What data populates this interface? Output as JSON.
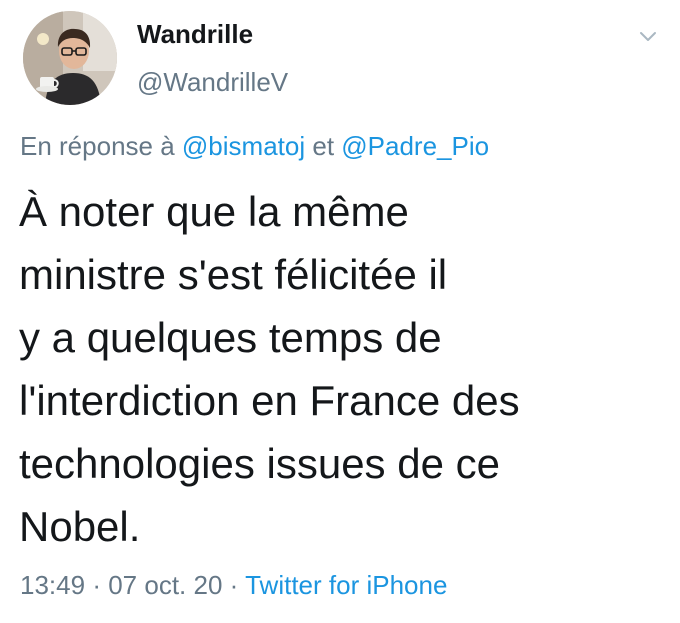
{
  "author": {
    "display_name": "Wandrille",
    "handle": "@WandrilleV",
    "avatar_icon": "user-avatar-photo"
  },
  "menu_icon": "chevron-down-icon",
  "reply": {
    "prefix": "En réponse à",
    "mention_1": "@bismatoj",
    "conjunction": "et",
    "mention_2": "@Padre_Pio"
  },
  "tweet": {
    "lines": [
      "À noter que la même",
      "ministre s'est félicitée il",
      "y a quelques temps de",
      "l'interdiction en France des",
      "technologies issues de ce",
      "Nobel."
    ]
  },
  "meta": {
    "time": "13:49",
    "separator": "·",
    "date": "07 oct. 20",
    "source": "Twitter for iPhone"
  },
  "colors": {
    "text": "#14171a",
    "secondary": "#657786",
    "link": "#1b95e0",
    "background": "#ffffff"
  }
}
